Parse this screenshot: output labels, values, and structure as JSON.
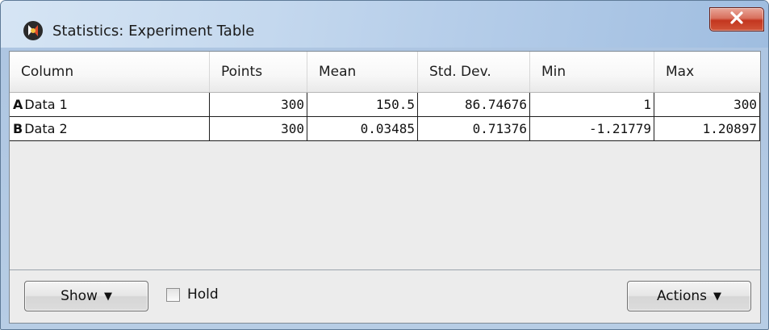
{
  "window": {
    "title": "Statistics: Experiment Table",
    "close_label": "X"
  },
  "table": {
    "columns": [
      "Column",
      "Points",
      "Mean",
      "Std. Dev.",
      "Min",
      "Max"
    ],
    "rows": [
      {
        "letter": "A",
        "name": "Data 1",
        "points": "300",
        "mean": "150.5",
        "std_dev": "86.74676",
        "min": "1",
        "max": "300"
      },
      {
        "letter": "B",
        "name": "Data 2",
        "points": "300",
        "mean": "0.03485",
        "std_dev": "0.71376",
        "min": "-1.21779",
        "max": "1.20897"
      }
    ]
  },
  "footer": {
    "show_label": "Show",
    "hold_label": "Hold",
    "hold_checked": false,
    "actions_label": "Actions",
    "dropdown_glyph": "▼"
  },
  "icons": {
    "app": "app-logo-icon",
    "close": "close-icon",
    "dropdown": "triangle-down-icon"
  }
}
